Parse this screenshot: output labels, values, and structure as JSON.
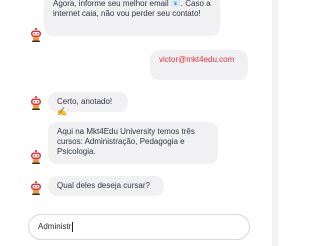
{
  "chat": {
    "messages": [
      {
        "from": "bot",
        "text": "Agora, informe seu melhor email 📧. Caso a internet caia, não vou perder seu contato!"
      },
      {
        "from": "user",
        "text": "victor@mkt4edu.com"
      },
      {
        "from": "bot",
        "text": "Certo, anotado! ✍"
      },
      {
        "from": "bot",
        "text": "Aqui na Mkt4Edu University temos três cursos: Administração, Pedagogia e Psicologia."
      },
      {
        "from": "bot",
        "text": "Qual deles deseja cursar?"
      }
    ]
  },
  "input": {
    "value": "Administr"
  },
  "icons": {
    "avatar": "robot-avatar-icon"
  }
}
